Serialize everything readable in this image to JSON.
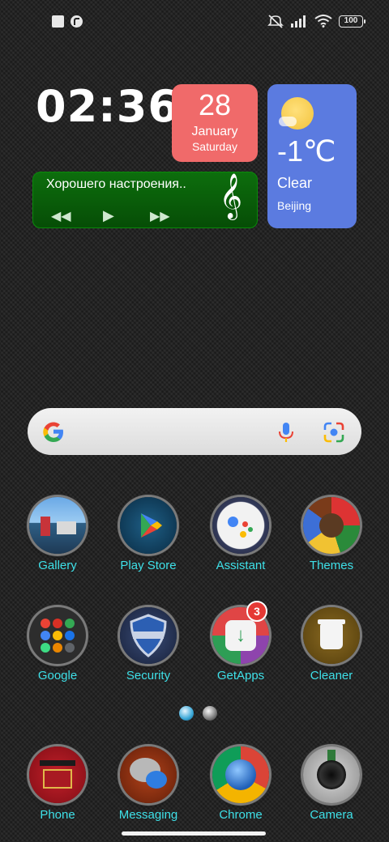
{
  "status_bar": {
    "battery": "100",
    "icons_left": [
      "square-icon",
      "notification-app-icon"
    ],
    "icons_right": [
      "mute-icon",
      "signal-icon",
      "wifi-icon",
      "battery-icon"
    ]
  },
  "widgets": {
    "clock": "02:36",
    "date": {
      "day": "28",
      "month": "January",
      "weekday": "Saturday",
      "color": "#f06a6a"
    },
    "weather": {
      "temp": "-1℃",
      "condition": "Clear",
      "city": "Beijing",
      "color": "#5b7be0"
    },
    "music": {
      "title": "Хорошего настроения..",
      "prev": "◀◀",
      "play": "▶",
      "next": "▶▶",
      "note": "𝄞"
    }
  },
  "search": {
    "logo": "google-g-icon",
    "mic": "mic-icon",
    "lens": "lens-icon"
  },
  "apps": [
    {
      "label": "Gallery"
    },
    {
      "label": "Play Store"
    },
    {
      "label": "Assistant"
    },
    {
      "label": "Themes"
    },
    {
      "label": "Google"
    },
    {
      "label": "Security"
    },
    {
      "label": "GetApps",
      "badge": "3"
    },
    {
      "label": "Cleaner"
    }
  ],
  "dock": [
    {
      "label": "Phone"
    },
    {
      "label": "Messaging"
    },
    {
      "label": "Chrome"
    },
    {
      "label": "Camera"
    }
  ],
  "accent_colors": {
    "label": "#3ee0e8"
  },
  "page_indicator": {
    "pages": 2,
    "current": 1
  }
}
